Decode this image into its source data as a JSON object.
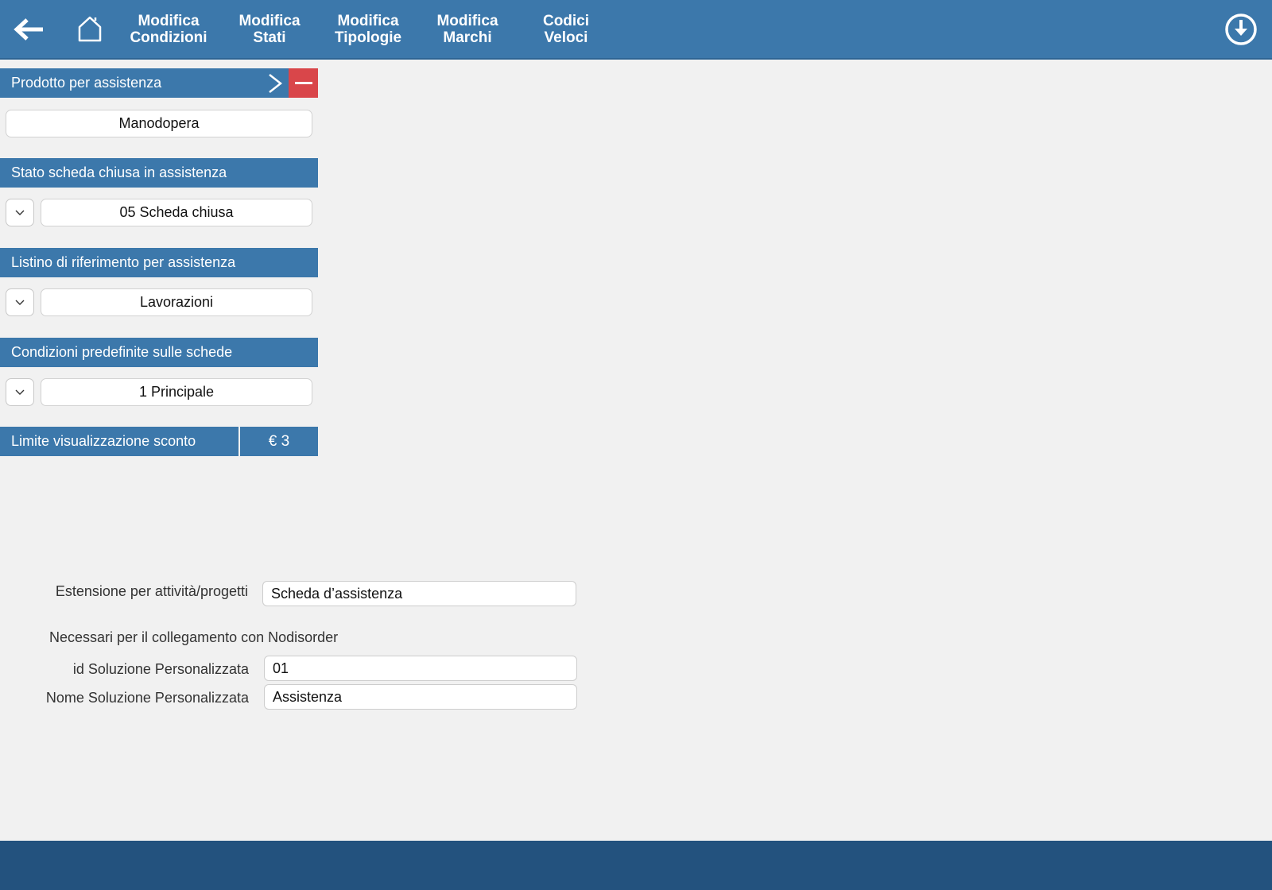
{
  "toolbar": {
    "back_icon": "arrow-left-icon",
    "home_icon": "home-icon",
    "download_icon": "download-circle-icon",
    "buttons": [
      {
        "line1": "Modifica",
        "line2": "Condizioni"
      },
      {
        "line1": "Modifica",
        "line2": "Stati"
      },
      {
        "line1": "Modifica",
        "line2": "Tipologie"
      },
      {
        "line1": "Modifica",
        "line2": "Marchi"
      },
      {
        "line1": "Codici",
        "line2": "Veloci"
      }
    ]
  },
  "panel": {
    "prodotto": {
      "title": "Prodotto per assistenza",
      "value": "Manodopera"
    },
    "stato": {
      "title": "Stato scheda chiusa in assistenza",
      "value": "05 Scheda chiusa"
    },
    "listino": {
      "title": "Listino di riferimento per assistenza",
      "value": "Lavorazioni"
    },
    "condizioni": {
      "title": "Condizioni predefinite sulle schede",
      "value": "1 Principale"
    },
    "limite": {
      "title": "Limite visualizzazione sconto",
      "value": "€ 3"
    }
  },
  "form": {
    "estensione_label": "Estensione per attività/progetti",
    "estensione_value": "Scheda d’assistenza",
    "note": "Necessari per il collegamento con Nodisorder",
    "id_label": "id Soluzione Personalizzata",
    "id_value": "01",
    "nome_label": "Nome Soluzione Personalizzata",
    "nome_value": "Assistenza"
  },
  "colors": {
    "header_blue": "#3c78ab",
    "footer_blue": "#23527e",
    "remove_red": "#d9464a",
    "background": "#f1f1f1"
  }
}
